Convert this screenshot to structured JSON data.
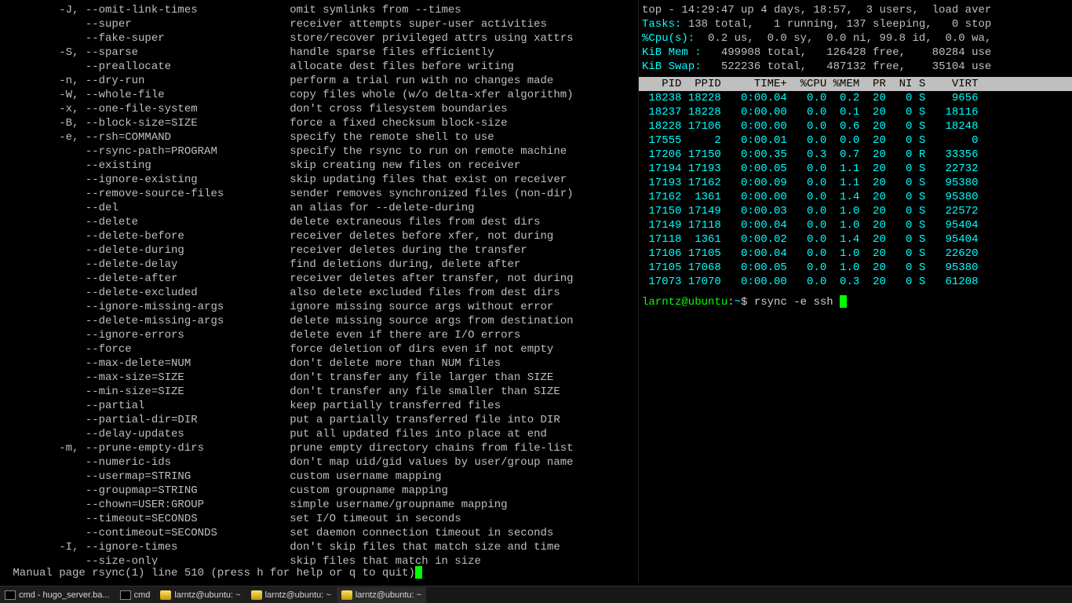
{
  "man": {
    "lines": [
      {
        "opt": " -J, --omit-link-times",
        "desc": "omit symlinks from --times"
      },
      {
        "opt": "     --super",
        "desc": "receiver attempts super-user activities"
      },
      {
        "opt": "     --fake-super",
        "desc": "store/recover privileged attrs using xattrs"
      },
      {
        "opt": " -S, --sparse",
        "desc": "handle sparse files efficiently"
      },
      {
        "opt": "     --preallocate",
        "desc": "allocate dest files before writing"
      },
      {
        "opt": " -n, --dry-run",
        "desc": "perform a trial run with no changes made"
      },
      {
        "opt": " -W, --whole-file",
        "desc": "copy files whole (w/o delta-xfer algorithm)"
      },
      {
        "opt": " -x, --one-file-system",
        "desc": "don't cross filesystem boundaries"
      },
      {
        "opt": " -B, --block-size=SIZE",
        "desc": "force a fixed checksum block-size"
      },
      {
        "opt": " -e, --rsh=COMMAND",
        "desc": "specify the remote shell to use"
      },
      {
        "opt": "     --rsync-path=PROGRAM",
        "desc": "specify the rsync to run on remote machine"
      },
      {
        "opt": "     --existing",
        "desc": "skip creating new files on receiver"
      },
      {
        "opt": "     --ignore-existing",
        "desc": "skip updating files that exist on receiver"
      },
      {
        "opt": "     --remove-source-files",
        "desc": "sender removes synchronized files (non-dir)"
      },
      {
        "opt": "     --del",
        "desc": "an alias for --delete-during"
      },
      {
        "opt": "     --delete",
        "desc": "delete extraneous files from dest dirs"
      },
      {
        "opt": "     --delete-before",
        "desc": "receiver deletes before xfer, not during"
      },
      {
        "opt": "     --delete-during",
        "desc": "receiver deletes during the transfer"
      },
      {
        "opt": "     --delete-delay",
        "desc": "find deletions during, delete after"
      },
      {
        "opt": "     --delete-after",
        "desc": "receiver deletes after transfer, not during"
      },
      {
        "opt": "     --delete-excluded",
        "desc": "also delete excluded files from dest dirs"
      },
      {
        "opt": "     --ignore-missing-args",
        "desc": "ignore missing source args without error"
      },
      {
        "opt": "     --delete-missing-args",
        "desc": "delete missing source args from destination"
      },
      {
        "opt": "     --ignore-errors",
        "desc": "delete even if there are I/O errors"
      },
      {
        "opt": "     --force",
        "desc": "force deletion of dirs even if not empty"
      },
      {
        "opt": "     --max-delete=NUM",
        "desc": "don't delete more than NUM files"
      },
      {
        "opt": "     --max-size=SIZE",
        "desc": "don't transfer any file larger than SIZE"
      },
      {
        "opt": "     --min-size=SIZE",
        "desc": "don't transfer any file smaller than SIZE"
      },
      {
        "opt": "     --partial",
        "desc": "keep partially transferred files"
      },
      {
        "opt": "     --partial-dir=DIR",
        "desc": "put a partially transferred file into DIR"
      },
      {
        "opt": "     --delay-updates",
        "desc": "put all updated files into place at end"
      },
      {
        "opt": " -m, --prune-empty-dirs",
        "desc": "prune empty directory chains from file-list"
      },
      {
        "opt": "     --numeric-ids",
        "desc": "don't map uid/gid values by user/group name"
      },
      {
        "opt": "     --usermap=STRING",
        "desc": "custom username mapping"
      },
      {
        "opt": "     --groupmap=STRING",
        "desc": "custom groupname mapping"
      },
      {
        "opt": "     --chown=USER:GROUP",
        "desc": "simple username/groupname mapping"
      },
      {
        "opt": "     --timeout=SECONDS",
        "desc": "set I/O timeout in seconds"
      },
      {
        "opt": "     --contimeout=SECONDS",
        "desc": "set daemon connection timeout in seconds"
      },
      {
        "opt": " -I, --ignore-times",
        "desc": "don't skip files that match size and time"
      },
      {
        "opt": "     --size-only",
        "desc": "skip files that match in size"
      }
    ],
    "status": " Manual page rsync(1) line 510 (press h for help or q to quit)"
  },
  "top": {
    "l1": "top - 14:29:47 up 4 days, 18:57,  3 users,  load aver",
    "tasks_label": "Tasks:",
    "tasks": " 138 total,   1 running, 137 sleeping,   0 stop",
    "cpu_label": "%Cpu(s):",
    "cpu": "  0.2 us,  0.0 sy,  0.0 ni, 99.8 id,  0.0 wa,",
    "mem_label": "KiB Mem :",
    "mem": "   499908 total,   126428 free,    80284 use",
    "swap_label": "KiB Swap:",
    "swap": "   522236 total,   487132 free,    35104 use",
    "hdr": "   PID  PPID     TIME+  %CPU %MEM  PR  NI S    VIRT ",
    "rows": [
      {
        "pid": "18238",
        "ppid": "18228",
        "time": "0:00.04",
        "cpu": "0.0",
        "mem": "0.2",
        "pr": "20",
        "ni": "0",
        "s": "S",
        "virt": "9656"
      },
      {
        "pid": "18237",
        "ppid": "18228",
        "time": "0:00.00",
        "cpu": "0.0",
        "mem": "0.1",
        "pr": "20",
        "ni": "0",
        "s": "S",
        "virt": "18116"
      },
      {
        "pid": "18228",
        "ppid": "17106",
        "time": "0:00.00",
        "cpu": "0.0",
        "mem": "0.6",
        "pr": "20",
        "ni": "0",
        "s": "S",
        "virt": "18248"
      },
      {
        "pid": "17555",
        "ppid": "2",
        "time": "0:00.01",
        "cpu": "0.0",
        "mem": "0.0",
        "pr": "20",
        "ni": "0",
        "s": "S",
        "virt": "0"
      },
      {
        "pid": "17206",
        "ppid": "17150",
        "time": "0:00.35",
        "cpu": "0.3",
        "mem": "0.7",
        "pr": "20",
        "ni": "0",
        "s": "R",
        "virt": "33356"
      },
      {
        "pid": "17194",
        "ppid": "17193",
        "time": "0:00.05",
        "cpu": "0.0",
        "mem": "1.1",
        "pr": "20",
        "ni": "0",
        "s": "S",
        "virt": "22732"
      },
      {
        "pid": "17193",
        "ppid": "17162",
        "time": "0:00.09",
        "cpu": "0.0",
        "mem": "1.1",
        "pr": "20",
        "ni": "0",
        "s": "S",
        "virt": "95380"
      },
      {
        "pid": "17162",
        "ppid": "1361",
        "time": "0:00.00",
        "cpu": "0.0",
        "mem": "1.4",
        "pr": "20",
        "ni": "0",
        "s": "S",
        "virt": "95380"
      },
      {
        "pid": "17150",
        "ppid": "17149",
        "time": "0:00.03",
        "cpu": "0.0",
        "mem": "1.0",
        "pr": "20",
        "ni": "0",
        "s": "S",
        "virt": "22572"
      },
      {
        "pid": "17149",
        "ppid": "17118",
        "time": "0:00.04",
        "cpu": "0.0",
        "mem": "1.0",
        "pr": "20",
        "ni": "0",
        "s": "S",
        "virt": "95404"
      },
      {
        "pid": "17118",
        "ppid": "1361",
        "time": "0:00.02",
        "cpu": "0.0",
        "mem": "1.4",
        "pr": "20",
        "ni": "0",
        "s": "S",
        "virt": "95404"
      },
      {
        "pid": "17106",
        "ppid": "17105",
        "time": "0:00.04",
        "cpu": "0.0",
        "mem": "1.0",
        "pr": "20",
        "ni": "0",
        "s": "S",
        "virt": "22620"
      },
      {
        "pid": "17105",
        "ppid": "17068",
        "time": "0:00.05",
        "cpu": "0.0",
        "mem": "1.0",
        "pr": "20",
        "ni": "0",
        "s": "S",
        "virt": "95380"
      },
      {
        "pid": "17073",
        "ppid": "17070",
        "time": "0:00.00",
        "cpu": "0.0",
        "mem": "0.3",
        "pr": "20",
        "ni": "0",
        "s": "S",
        "virt": "61208"
      }
    ],
    "prompt_user": "larntz@ubuntu",
    "prompt_sep": ":",
    "prompt_path": "~",
    "prompt_dollar": "$ ",
    "prompt_cmd": "rsync -e ssh "
  },
  "taskbar": {
    "items": [
      {
        "icon": "cmd",
        "label": "cmd - hugo_server.ba..."
      },
      {
        "icon": "cmd",
        "label": "cmd"
      },
      {
        "icon": "putty",
        "label": "larntz@ubuntu: ~"
      },
      {
        "icon": "putty",
        "label": "larntz@ubuntu: ~"
      },
      {
        "icon": "putty",
        "label": "larntz@ubuntu: ~",
        "active": true
      }
    ]
  }
}
